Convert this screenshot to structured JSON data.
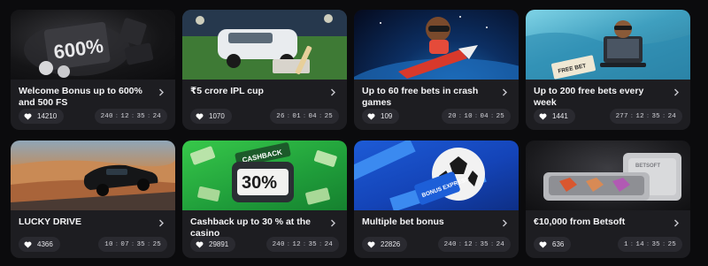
{
  "cards": [
    {
      "title": "Welcome Bonus up to 600% and 500 FS",
      "likes": "14210",
      "timer": [
        "240",
        "12",
        "35",
        "24"
      ],
      "art_text": "600%",
      "icon": "chevron-right-icon"
    },
    {
      "title": "₹5 crore IPL cup",
      "likes": "1070",
      "timer": [
        "26",
        "01",
        "04",
        "25"
      ],
      "icon": "chevron-right-icon"
    },
    {
      "title": "Up to 60 free bets in crash games",
      "likes": "109",
      "timer": [
        "20",
        "10",
        "04",
        "25"
      ],
      "icon": "chevron-right-icon"
    },
    {
      "title": "Up to 200 free bets every week",
      "likes": "1441",
      "timer": [
        "277",
        "12",
        "35",
        "24"
      ],
      "art_text": "FREE BET",
      "icon": "chevron-right-icon"
    },
    {
      "title": "LUCKY DRIVE",
      "likes": "4366",
      "timer": [
        "10",
        "07",
        "35",
        "25"
      ],
      "icon": "chevron-right-icon"
    },
    {
      "title": "Cashback up to 30 % at the casino",
      "likes": "29891",
      "timer": [
        "240",
        "12",
        "35",
        "24"
      ],
      "art_text": "30%",
      "art_label": "CASHBACK",
      "icon": "chevron-right-icon"
    },
    {
      "title": "Multiple bet bonus",
      "likes": "22826",
      "timer": [
        "240",
        "12",
        "35",
        "24"
      ],
      "art_text": "BONUS EXPRESS",
      "icon": "chevron-right-icon"
    },
    {
      "title": "€10,000 from Betsoft",
      "likes": "636",
      "timer": [
        "1",
        "14",
        "35",
        "25"
      ],
      "art_text": "BETSOFT",
      "icon": "chevron-right-icon"
    }
  ],
  "colors": {
    "page_bg": "#0b0b0d",
    "card_bg": "#1d1d21",
    "pill_bg": "#2a2a30",
    "text": "#f4f4f6"
  }
}
